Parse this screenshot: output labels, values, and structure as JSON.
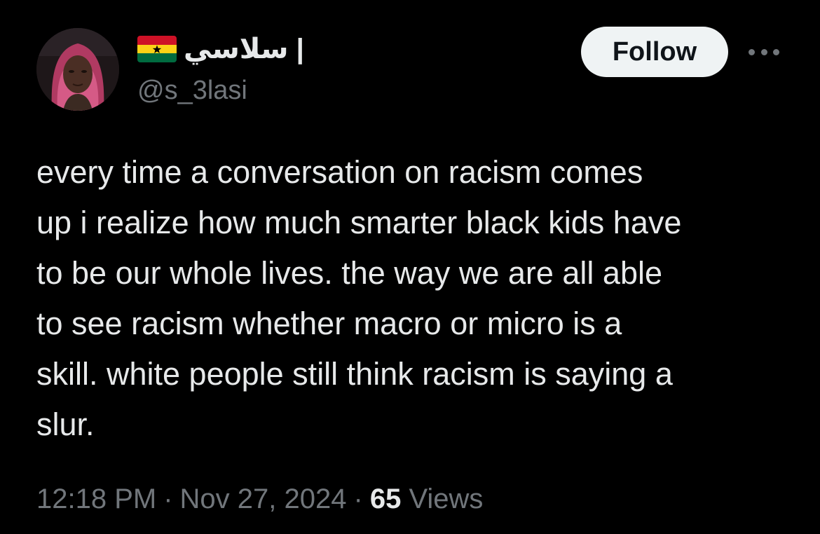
{
  "author": {
    "display_name": "سلاسي |",
    "handle": "@s_3lasi",
    "flag_icon": "ghana-flag-icon",
    "avatar_icon": "avatar"
  },
  "actions": {
    "follow_label": "Follow",
    "more_icon": "more-horizontal-icon"
  },
  "tweet": {
    "text": "every time a conversation on racism comes\nup i realize how much smarter black kids have\nto be our whole lives. the way we are all able\nto see racism whether macro or micro is a\nskill. white people still think racism is saying a\nslur."
  },
  "meta": {
    "time": "12:18 PM",
    "separator": "·",
    "date": "Nov 27, 2024",
    "views_count": "65",
    "views_label": "Views"
  },
  "colors": {
    "background": "#000000",
    "text_primary": "#e7e9ea",
    "text_secondary": "#71767b",
    "button_bg": "#eff3f4",
    "button_text": "#0f1419",
    "flag_red": "#ce1126",
    "flag_gold": "#fcd116",
    "flag_green": "#006b3f"
  }
}
